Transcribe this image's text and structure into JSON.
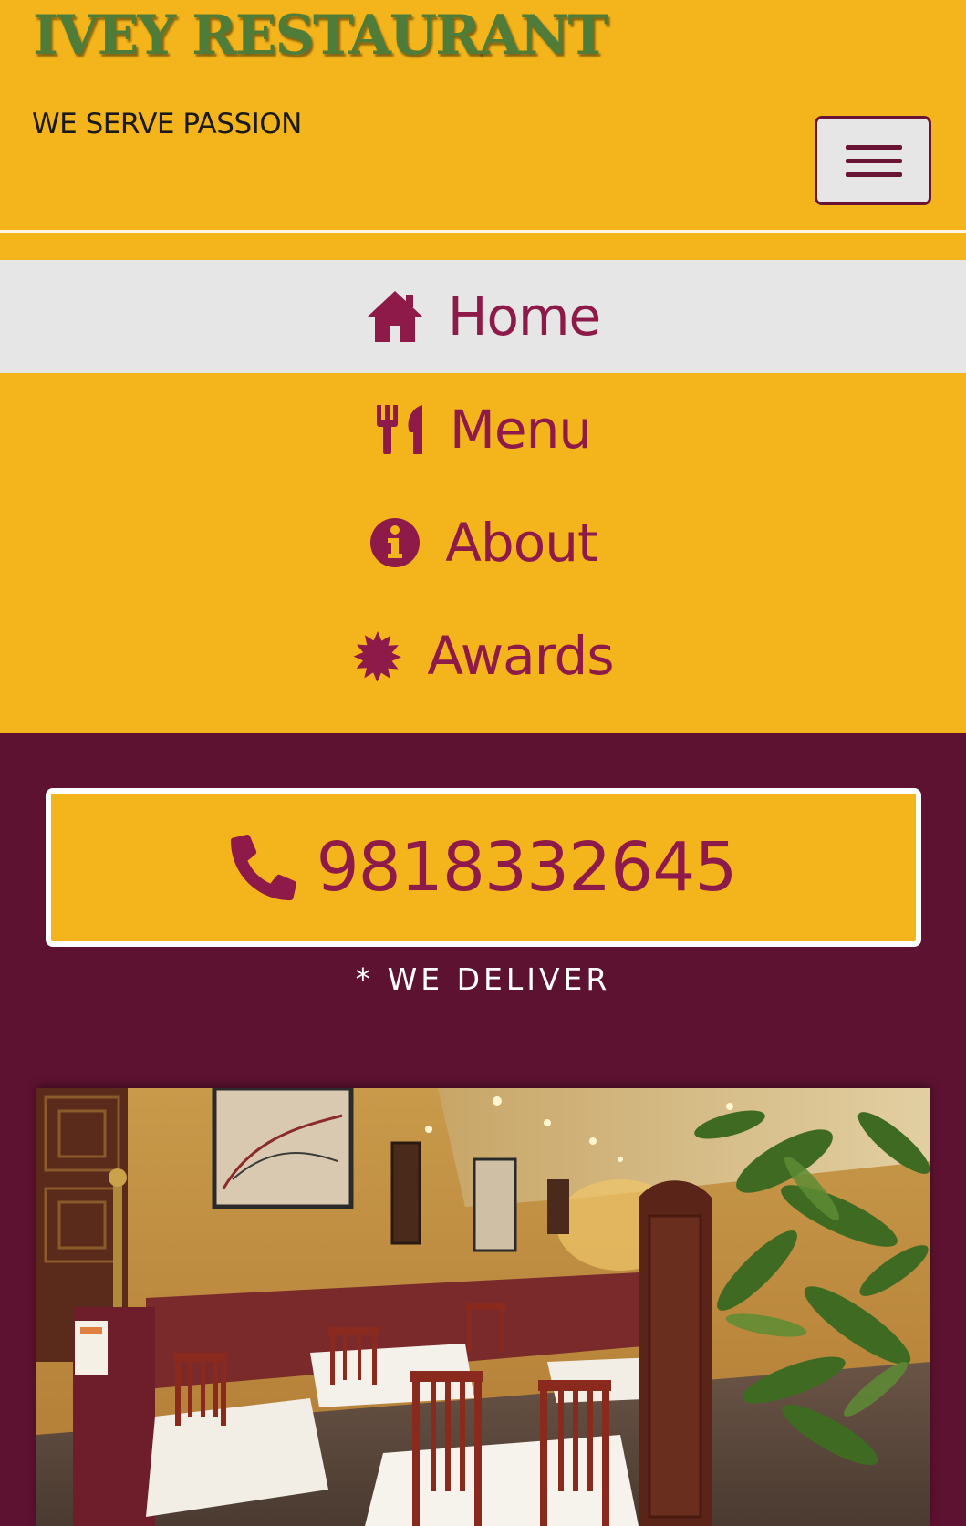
{
  "header": {
    "brand": "IVEY RESTAURANT",
    "tagline": "WE SERVE PASSION",
    "menu_toggle_icon": "hamburger-icon"
  },
  "nav": {
    "items": [
      {
        "label": "Home",
        "icon": "home-icon",
        "active": true
      },
      {
        "label": "Menu",
        "icon": "utensils-icon",
        "active": false
      },
      {
        "label": "About",
        "icon": "info-icon",
        "active": false
      },
      {
        "label": "Awards",
        "icon": "certificate-icon",
        "active": false
      }
    ]
  },
  "contact": {
    "phone": "9818332645",
    "icon": "phone-icon",
    "note": "* WE DELIVER"
  },
  "colors": {
    "header_bg": "#f4b41b",
    "brand_green": "#4f7c38",
    "accent_maroon": "#8e1a4a",
    "page_bg": "#5e1231",
    "active_nav_bg": "#e6e6e6"
  }
}
